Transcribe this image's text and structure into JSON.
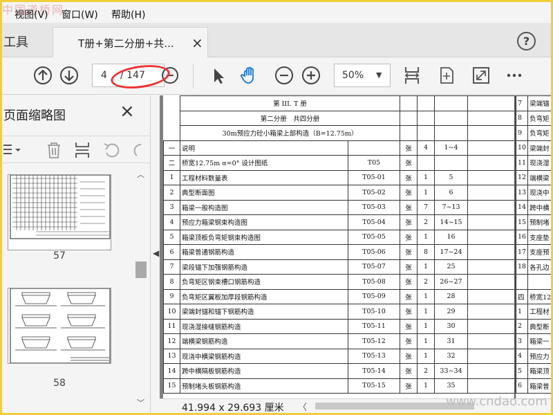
{
  "watermark_top": "中国道桥网",
  "watermark_bottom": "www.cndao.com",
  "menu": {
    "view": "视图(V)",
    "window": "窗口(W)",
    "help": "帮助(H)"
  },
  "tabs": {
    "tools": "工具",
    "doc_title": "T册+第二分册+共...",
    "close": "×",
    "help": "?"
  },
  "toolbar": {
    "page_current": "4",
    "page_total": "/ 147",
    "zoom": "50%"
  },
  "thumbnails": {
    "title": "页面缩略图",
    "close": "×",
    "pages": [
      {
        "label": "57"
      },
      {
        "label": "58"
      }
    ]
  },
  "document": {
    "header_row1": "第 III. T 册",
    "header_row2": "第二分册　共四分册",
    "header_row3": "30m预应力砼小箱梁上部构造（B=12.75m）",
    "rows": [
      {
        "no": "一",
        "name": "说明",
        "code": "",
        "unit": "张",
        "count": "4",
        "pages": "1~4"
      },
      {
        "no": "二",
        "name": "桥宽12.75m α=0° 设计图纸",
        "code": "T05",
        "unit": "张",
        "count": "",
        "pages": ""
      },
      {
        "no": "1",
        "name": "工程材料数量表",
        "code": "T05-01",
        "unit": "张",
        "count": "1",
        "pages": "5"
      },
      {
        "no": "2",
        "name": "典型断面图",
        "code": "T05-02",
        "unit": "张",
        "count": "1",
        "pages": "6"
      },
      {
        "no": "3",
        "name": "箱梁一般构造图",
        "code": "T05-03",
        "unit": "张",
        "count": "7",
        "pages": "7~13"
      },
      {
        "no": "4",
        "name": "预应力箱梁钢束构造图",
        "code": "T05-04",
        "unit": "张",
        "count": "2",
        "pages": "14~15"
      },
      {
        "no": "5",
        "name": "箱梁顶板负弯矩钢束构造图",
        "code": "T05-05",
        "unit": "张",
        "count": "1",
        "pages": "16"
      },
      {
        "no": "6",
        "name": "箱梁普通钢筋构造",
        "code": "T05-06",
        "unit": "张",
        "count": "8",
        "pages": "17~24"
      },
      {
        "no": "7",
        "name": "梁段锚下加强钢筋构造",
        "code": "T05-07",
        "unit": "张",
        "count": "1",
        "pages": "25"
      },
      {
        "no": "8",
        "name": "负弯矩区钢束槽口钢筋构造",
        "code": "T05-08",
        "unit": "张",
        "count": "2",
        "pages": "26~27"
      },
      {
        "no": "9",
        "name": "负弯矩区翼板加厚段钢筋构造",
        "code": "T05-09",
        "unit": "张",
        "count": "1",
        "pages": "28"
      },
      {
        "no": "10",
        "name": "梁端封锚和锚下钢筋构造",
        "code": "T05-10",
        "unit": "张",
        "count": "1",
        "pages": "29"
      },
      {
        "no": "11",
        "name": "现浇湿接缝钢筋构造",
        "code": "T05-11",
        "unit": "张",
        "count": "1",
        "pages": "30"
      },
      {
        "no": "12",
        "name": "端横梁钢筋构造",
        "code": "T05-12",
        "unit": "张",
        "count": "1",
        "pages": "31"
      },
      {
        "no": "13",
        "name": "现浇中横梁钢筋构造",
        "code": "T05-13",
        "unit": "张",
        "count": "1",
        "pages": "32"
      },
      {
        "no": "14",
        "name": "跨中横隔板钢筋构造",
        "code": "T05-14",
        "unit": "张",
        "count": "2",
        "pages": "33~34"
      },
      {
        "no": "15",
        "name": "预制堵头板钢筋构造",
        "code": "T05-15",
        "unit": "张",
        "count": "1",
        "pages": "35"
      }
    ],
    "right_rows": [
      {
        "no": "7",
        "name": "梁端锚"
      },
      {
        "no": "8",
        "name": "负弯矩"
      },
      {
        "no": "9",
        "name": "负弯矩"
      },
      {
        "no": "10",
        "name": "梁端封"
      },
      {
        "no": "11",
        "name": "现浇湿"
      },
      {
        "no": "12",
        "name": "端横梁"
      },
      {
        "no": "13",
        "name": "现浇中"
      },
      {
        "no": "14",
        "name": "跨中横"
      },
      {
        "no": "15",
        "name": "预制堵"
      },
      {
        "no": "16",
        "name": "支座垫"
      },
      {
        "no": "17",
        "name": "支座预"
      },
      {
        "no": "18",
        "name": "各孔边"
      },
      {
        "no": "",
        "name": ""
      },
      {
        "no": "四",
        "name": "桥宽12"
      },
      {
        "no": "1",
        "name": "工程材"
      },
      {
        "no": "2",
        "name": "典型断"
      },
      {
        "no": "3",
        "name": "箱梁一"
      },
      {
        "no": "4",
        "name": "预应力"
      },
      {
        "no": "5",
        "name": "箱梁顶"
      },
      {
        "no": "6",
        "name": "箱梁普"
      }
    ]
  },
  "status": {
    "page_size": "41.994 x 29.693 厘米"
  }
}
